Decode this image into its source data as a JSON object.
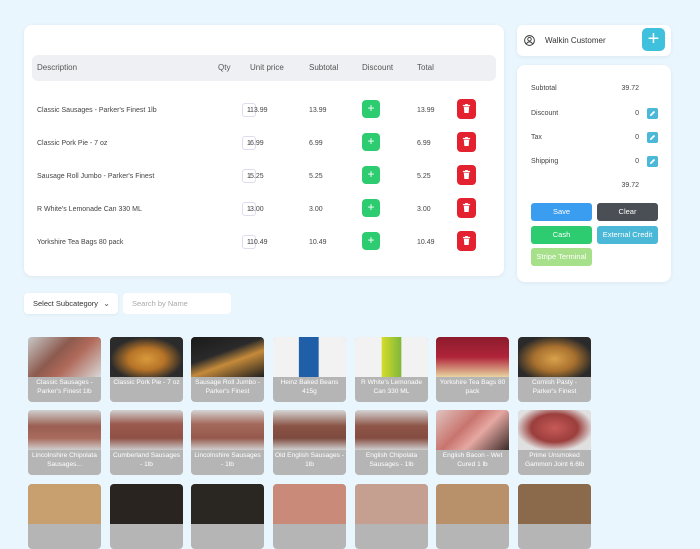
{
  "cart": {
    "headers": {
      "description": "Description",
      "qty": "Qty",
      "unit_price": "Unit price",
      "subtotal": "Subtotal",
      "discount": "Discount",
      "total": "Total"
    },
    "rows": [
      {
        "description": "Classic Sausages - Parker's Finest 1lb",
        "qty": "1",
        "unit_price": "13.99",
        "subtotal": "13.99",
        "total": "13.99"
      },
      {
        "description": "Classic Pork Pie - 7 oz",
        "qty": "1",
        "unit_price": "6.99",
        "subtotal": "6.99",
        "total": "6.99"
      },
      {
        "description": "Sausage Roll Jumbo - Parker's Finest",
        "qty": "1",
        "unit_price": "5.25",
        "subtotal": "5.25",
        "total": "5.25"
      },
      {
        "description": "R White's Lemonade Can 330 ML",
        "qty": "1",
        "unit_price": "3.00",
        "subtotal": "3.00",
        "total": "3.00"
      },
      {
        "description": "Yorkshire Tea Bags 80 pack",
        "qty": "1",
        "unit_price": "10.49",
        "subtotal": "10.49",
        "total": "10.49"
      }
    ],
    "discount_glyph": "+"
  },
  "customer": {
    "name": "Walkin Customer",
    "add_glyph": "+"
  },
  "summary": {
    "subtotal_label": "Subtotal",
    "subtotal_value": "39.72",
    "discount_label": "Discount",
    "discount_value": "0",
    "tax_label": "Tax",
    "tax_value": "0",
    "shipping_label": "Shipping",
    "shipping_value": "0",
    "total_value": "39.72",
    "buttons": {
      "save": "Save",
      "clear": "Clear",
      "cash": "Cash",
      "external_credit": "External Credit",
      "stripe": "Stripe Terminal"
    }
  },
  "filters": {
    "subcategory": "Select Subcategory",
    "search_placeholder": "Search by Name"
  },
  "products": [
    {
      "name": "Classic Sausages - Parker's Finest 1lb"
    },
    {
      "name": "Classic Pork Pie - 7 oz"
    },
    {
      "name": "Sausage Roll Jumbo - Parker's Finest"
    },
    {
      "name": "Heinz Baked Beans 415g"
    },
    {
      "name": "R White's Lemonade Can 330 ML"
    },
    {
      "name": "Yorkshire Tea Bags 80 pack"
    },
    {
      "name": "Cornish Pasty - Parker's Finest"
    },
    {
      "name": "Lincolnshire Chipolata Sausages..."
    },
    {
      "name": "Cumberland Sausages - 1lb"
    },
    {
      "name": "Lincolnshire Sausages - 1lb"
    },
    {
      "name": "Old English Sausages - 1lb"
    },
    {
      "name": "English Chipolata Sausages - 1lb"
    },
    {
      "name": "English Bacon - Wet Cured 1 lb"
    },
    {
      "name": "Prime Unsmoked Gammon Joint 6.6lb"
    }
  ],
  "colors": {
    "green": "#2ecc71",
    "red": "#e4212e",
    "teal": "#4ab8d6",
    "blue": "#3b9df0",
    "dark": "#4a4f55",
    "light_green": "#a6e08a",
    "bg": "#eaf6fd"
  }
}
